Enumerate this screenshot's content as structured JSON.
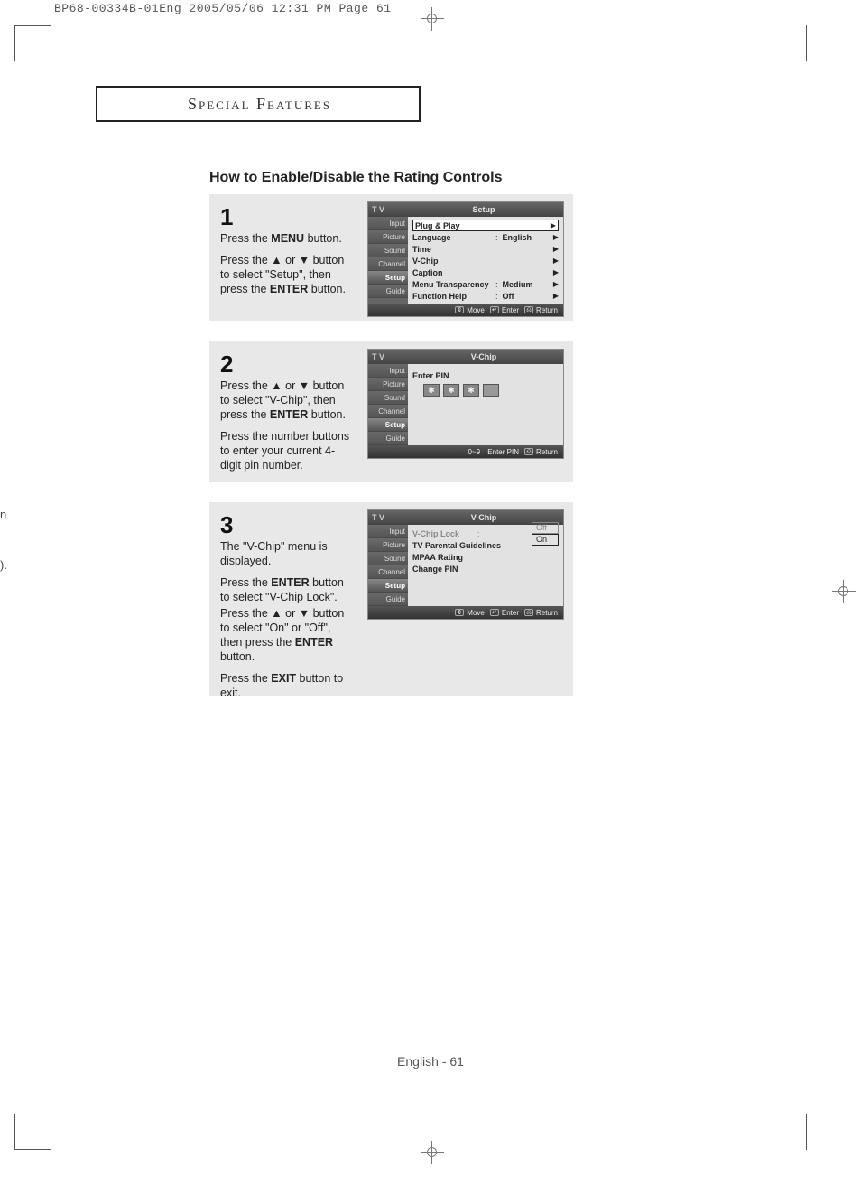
{
  "crop_header": "BP68-00334B-01Eng  2005/05/06  12:31 PM  Page 61",
  "edge_text_1": "n",
  "edge_text_2": ").",
  "section_title": "Special Features",
  "page_title": "How to Enable/Disable the Rating Controls",
  "footer": "English - 61",
  "step1": {
    "num": "1",
    "p1a": "Press the ",
    "p1b": "MENU",
    "p1c": " button.",
    "p2a": "Press the ",
    "up": "▲",
    "or": " or ",
    "down": "▼",
    "p2b": " button to select \"Setup\", then press the ",
    "p2c": "ENTER",
    "p2d": " button."
  },
  "step2": {
    "num": "2",
    "p1a": "Press the ",
    "up": "▲",
    "or": " or ",
    "down": "▼",
    "p1b": " button to select \"V-Chip\", then press the ",
    "p1c": "ENTER",
    "p1d": " button.",
    "p2": "Press the number buttons to enter your current 4-digit pin number."
  },
  "step3": {
    "num": "3",
    "p1": "The \"V-Chip\" menu is displayed.",
    "p2a": "Press the ",
    "p2b": "ENTER",
    "p2c": " button to select \"V-Chip Lock\".",
    "p3a": "Press the ",
    "up": "▲",
    "or": " or ",
    "down": "▼",
    "p3b": " button to select \"On\" or \"Off\", then press the ",
    "p3c": "ENTER",
    "p3d": " button.",
    "p4a": "Press the ",
    "p4b": "EXIT",
    "p4c": " button to exit."
  },
  "osd_sidebar": [
    "Input",
    "Picture",
    "Sound",
    "Channel",
    "Setup",
    "Guide"
  ],
  "osd1": {
    "tv": "T V",
    "title": "Setup",
    "rows": [
      {
        "label": "Plug & Play",
        "val": "",
        "arrow": "▶",
        "sel": true
      },
      {
        "label": "Language",
        "colon": ":",
        "val": "English",
        "arrow": "▶"
      },
      {
        "label": "Time",
        "val": "",
        "arrow": "▶"
      },
      {
        "label": "V-Chip",
        "val": "",
        "arrow": "▶"
      },
      {
        "label": "Caption",
        "val": "",
        "arrow": "▶"
      },
      {
        "label": "Menu Transparency",
        "colon": ":",
        "val": "Medium",
        "arrow": "▶"
      },
      {
        "label": "Function Help",
        "colon": ":",
        "val": "Off",
        "arrow": "▶"
      }
    ],
    "footer": {
      "move": "Move",
      "move_icon": "⇕",
      "enter": "Enter",
      "enter_icon": "↵",
      "return": "Return",
      "return_icon": "⎌"
    }
  },
  "osd2": {
    "tv": "T V",
    "title": "V-Chip",
    "enter_pin": "Enter PIN",
    "stars": [
      "✱",
      "✱",
      "✱",
      ""
    ],
    "footer": {
      "num": "0~9",
      "enterpin": "Enter PIN",
      "return": "Return",
      "return_icon": "⎌"
    }
  },
  "osd3": {
    "tv": "T V",
    "title": "V-Chip",
    "rows": [
      {
        "label": "V-Chip Lock",
        "colon": ":",
        "opts": [
          "Off",
          "On"
        ]
      },
      {
        "label": "TV Parental Guidelines"
      },
      {
        "label": "MPAA Rating"
      },
      {
        "label": "Change PIN"
      }
    ],
    "footer": {
      "move": "Move",
      "move_icon": "⇕",
      "enter": "Enter",
      "enter_icon": "↵",
      "return": "Return",
      "return_icon": "⎌"
    }
  }
}
